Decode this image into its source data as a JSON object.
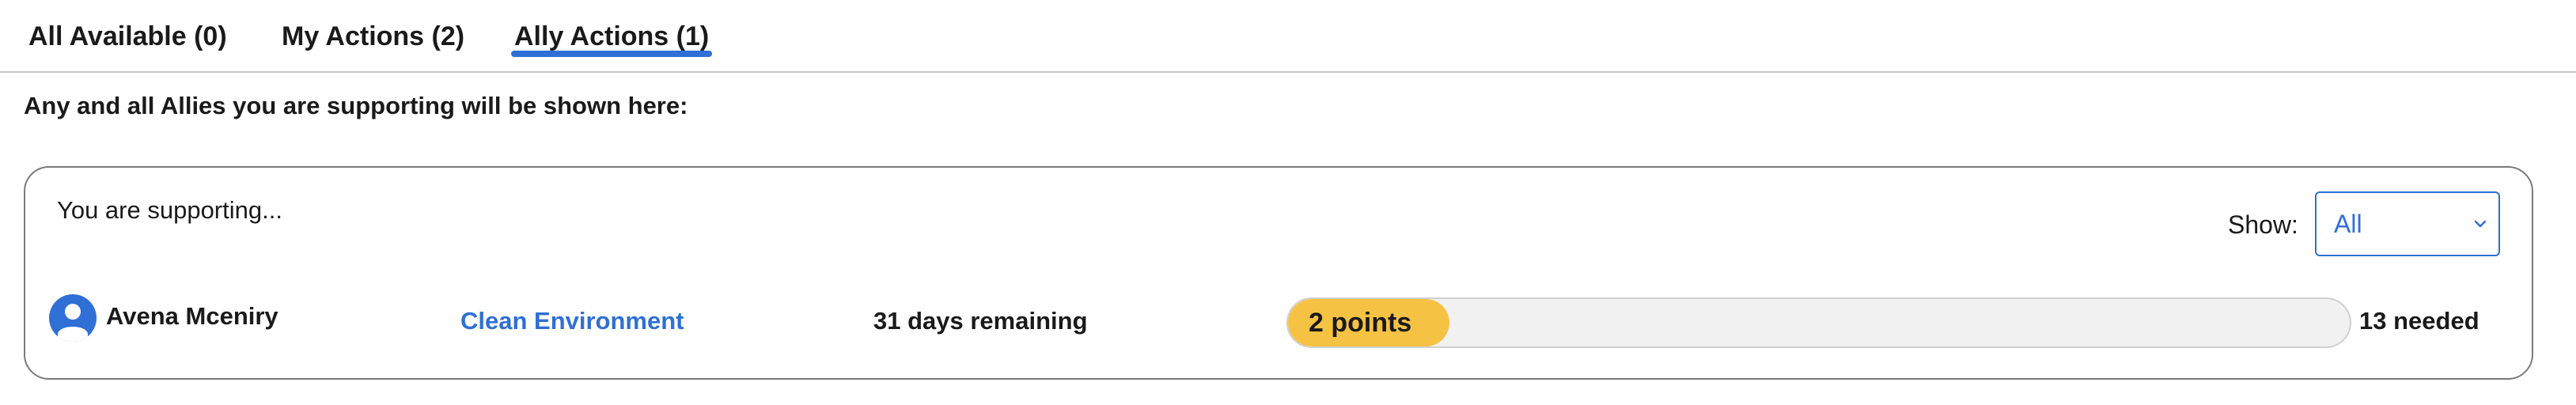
{
  "tabs": [
    {
      "label": "All Available (0)",
      "active": false
    },
    {
      "label": "My Actions (2)",
      "active": false
    },
    {
      "label": "Ally Actions (1)",
      "active": true
    }
  ],
  "intro": "Any and all Allies you are supporting will be shown here:",
  "card": {
    "heading": "You are supporting...",
    "filter": {
      "label": "Show:",
      "selected": "All"
    },
    "ally": {
      "avatar_icon": "user-icon",
      "name": "Avena Mceniry",
      "cause": "Clean Environment",
      "remaining": "31 days remaining",
      "progress": {
        "label": "2 points",
        "fraction": 0.1333
      },
      "needed": "13 needed"
    }
  },
  "colors": {
    "accent": "#2f6fd6",
    "progress_fill": "#f6c244",
    "progress_track": "#f1f1f1"
  }
}
